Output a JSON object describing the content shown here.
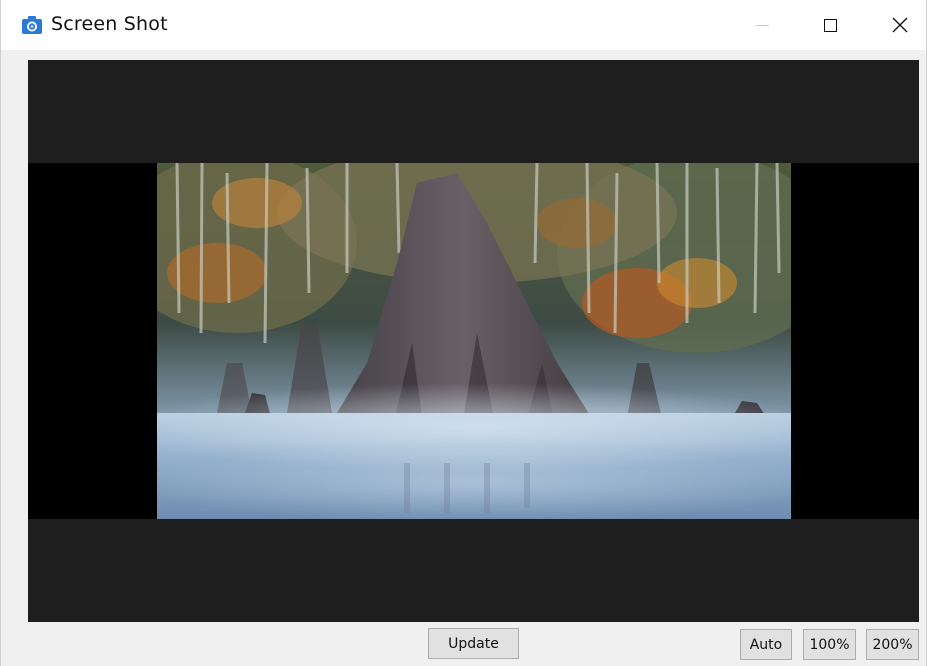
{
  "window": {
    "title": "Screen Shot",
    "icon": "camera-icon",
    "controls": [
      "minimize-icon",
      "maximize-icon",
      "close-icon"
    ]
  },
  "preview": {
    "image_description_icon": "screenshot-image"
  },
  "toolbar": {
    "update_label": "Update",
    "zoom_auto_label": "Auto",
    "zoom_100_label": "100%",
    "zoom_200_label": "200%"
  },
  "colors": {
    "accent": "#1a6fc9",
    "viewport_bg": "#1e1e1e",
    "letterbox_bg": "#000000"
  }
}
